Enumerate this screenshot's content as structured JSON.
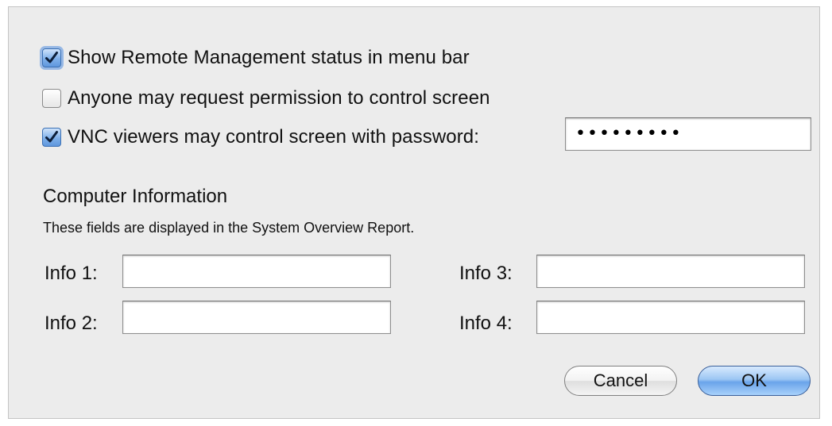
{
  "options": {
    "show_status": {
      "label": "Show Remote Management status in menu bar",
      "checked": true
    },
    "anyone_request": {
      "label": "Anyone may request permission to control screen",
      "checked": false
    },
    "vnc_password": {
      "label": "VNC viewers may control screen with password:",
      "checked": true,
      "password_masked": "•••••••••"
    }
  },
  "computer_info": {
    "title": "Computer Information",
    "description": "These fields are displayed in the System Overview Report.",
    "info1_label": "Info 1:",
    "info2_label": "Info 2:",
    "info3_label": "Info 3:",
    "info4_label": "Info 4:",
    "info1_value": "",
    "info2_value": "",
    "info3_value": "",
    "info4_value": ""
  },
  "buttons": {
    "cancel_label": "Cancel",
    "ok_label": "OK"
  },
  "colors": {
    "dialog_background": "#ececec",
    "checked_accent": "#5f97dd",
    "default_button": "#6aa4ea"
  }
}
